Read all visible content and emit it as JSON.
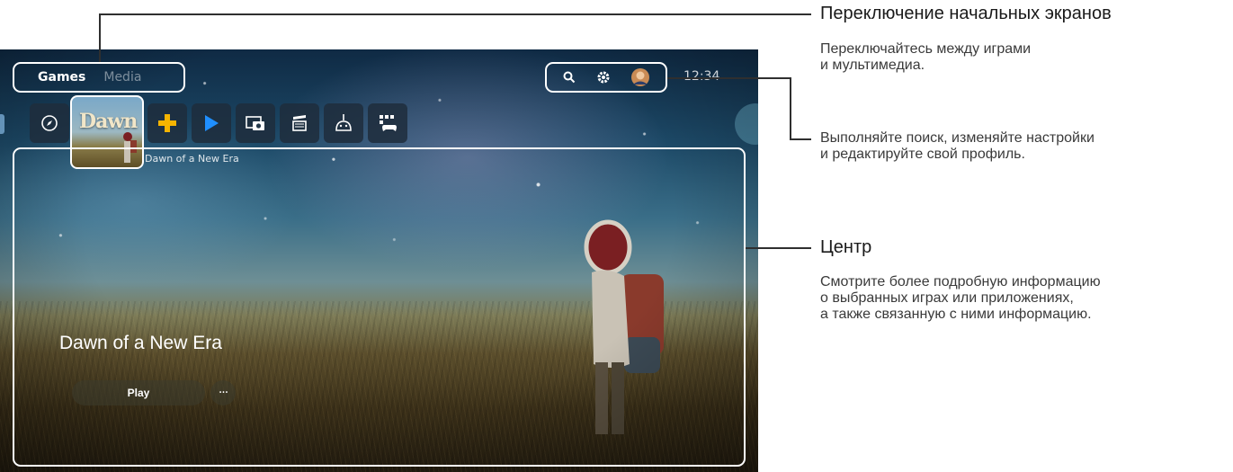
{
  "tabs": [
    {
      "label": "Games",
      "active": true
    },
    {
      "label": "Media",
      "active": false
    }
  ],
  "clock": "12:34",
  "selected_game": {
    "tile_logo": "Dawn",
    "caption": "Dawn of a New Era",
    "title": "Dawn of a New Era"
  },
  "hub": {
    "play_label": "Play",
    "more_label": "···"
  },
  "icons": {
    "utility": [
      "search-icon",
      "gear-icon",
      "avatar"
    ],
    "row": [
      "explore-icon",
      "ps-plus-icon",
      "ps-store-icon",
      "media-gallery-icon",
      "tv-video-icon",
      "game-library-icon",
      "game-base-icon"
    ]
  },
  "callouts": {
    "switch_title": "Переключение начальных экранов",
    "switch_desc": "Переключайтесь между играми\nи мультимедиа.",
    "utility_desc": "Выполняйте поиск, изменяйте настройки\nи редактируйте свой профиль.",
    "hub_title": "Центр",
    "hub_desc": "Смотрите более подробную информацию\nо выбранных играх или приложениях,\nа также связанную с ними информацию."
  }
}
